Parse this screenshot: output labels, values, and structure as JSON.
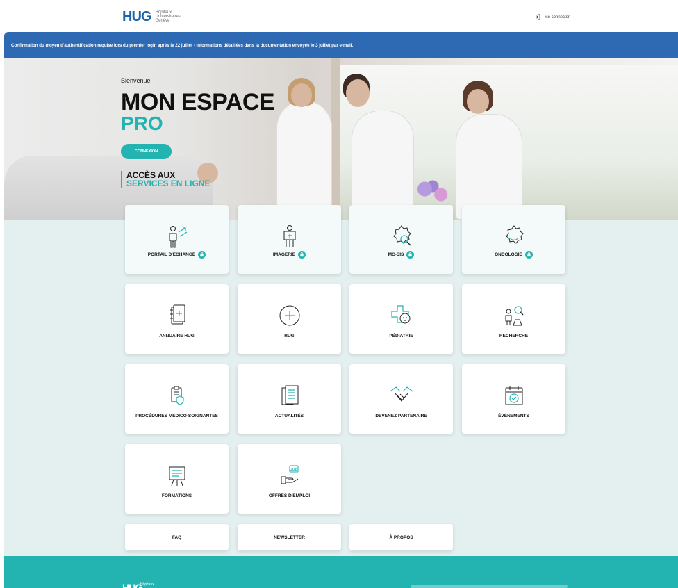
{
  "header": {
    "logo_mark": "HUG",
    "logo_lines": [
      "Hôpitaux",
      "Universitaires",
      "Genève"
    ],
    "login_label": "Me connecter"
  },
  "banner": {
    "text": "Confirmation du moyen d'authentification requise lors du premier login après le 22 juillet - Informations détaillées dans la documentation envoyée le 3 juillet par e-mail."
  },
  "hero": {
    "welcome": "Bienvenue",
    "title_line1": "MON ESPACE",
    "title_line2": "PRO",
    "cta_label": "CONNEXION",
    "access_line1": "ACCÈS AUX",
    "access_line2": "SERVICES EN LIGNE"
  },
  "tiles": [
    {
      "label": "PORTAIL D'ÉCHANGE",
      "icon": "doctor-exchange-icon",
      "locked": true
    },
    {
      "label": "IMAGERIE",
      "icon": "imaging-icon",
      "locked": true
    },
    {
      "label": "MC-SIS",
      "icon": "gear-search-icon",
      "locked": true
    },
    {
      "label": "ONCOLOGIE",
      "icon": "cell-icon",
      "locked": true
    },
    {
      "label": "ANNUAIRE HUG",
      "icon": "directory-icon",
      "locked": false
    },
    {
      "label": "RUG",
      "icon": "plus-circle-icon",
      "locked": false
    },
    {
      "label": "PÉDIATRIE",
      "icon": "baby-cross-icon",
      "locked": false
    },
    {
      "label": "RECHERCHE",
      "icon": "research-icon",
      "locked": false
    },
    {
      "label": "PROCÉDURES MÉDICO-SOIGNANTES",
      "icon": "clipboard-shield-icon",
      "locked": false
    },
    {
      "label": "ACTUALITÉS",
      "icon": "news-icon",
      "locked": false
    },
    {
      "label": "DEVENEZ PARTENAIRE",
      "icon": "handshake-icon",
      "locked": false
    },
    {
      "label": "ÉVÉNEMENTS",
      "icon": "calendar-check-icon",
      "locked": false
    },
    {
      "label": "FORMATIONS",
      "icon": "presentation-board-icon",
      "locked": false
    },
    {
      "label": "OFFRES D'EMPLOI",
      "icon": "job-offer-icon",
      "locked": false
    }
  ],
  "small_links": [
    "FAQ",
    "NEWSLETTER",
    "À PROPOS"
  ],
  "footer": {
    "logo_mark": "HUG",
    "logo_text": "Hôpitaux"
  },
  "colors": {
    "accent": "#23b3b0",
    "banner": "#2e6ab3",
    "grid_background": "#e3f0ef"
  }
}
